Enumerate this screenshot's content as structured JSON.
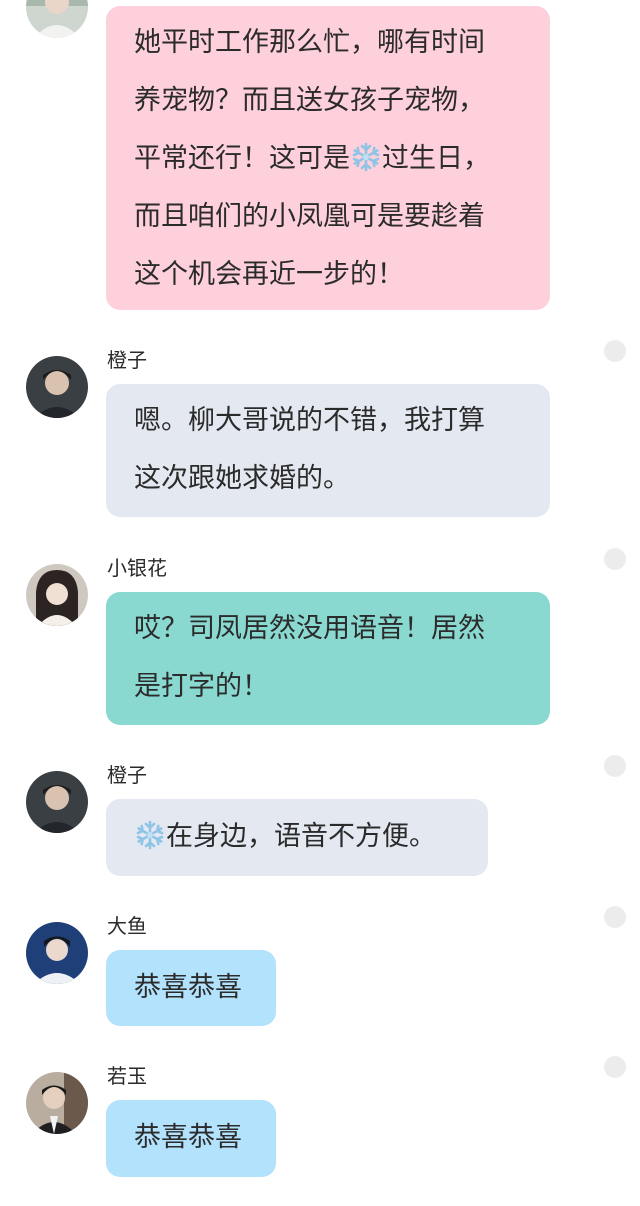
{
  "colors": {
    "pink_bubble": "#fdd0db",
    "gray_bubble": "#e3e8f1",
    "teal_bubble": "#8ad9d0",
    "blue_bubble": "#b3e2fd",
    "unread_dot": "#ececec",
    "snowflake": "#8fc4e6"
  },
  "messages": [
    {
      "sender": "",
      "avatar": "avatar-girl-light",
      "lines": [
        "她平时工作那么忙，哪有时间",
        "养宠物？而且送女孩子宠物，",
        "平常还行！这可是",
        "过生日，",
        "而且咱们的小凤凰可是要趁着",
        "这个机会再近一步的！"
      ],
      "snowflake_icon": "snowflake-icon"
    },
    {
      "sender": "橙子",
      "avatar": "avatar-boy-dark",
      "lines": [
        "嗯。柳大哥说的不错，我打算",
        "这次跟她求婚的。"
      ]
    },
    {
      "sender": "小银花",
      "avatar": "avatar-girl-dark-hair",
      "lines": [
        "哎？司凤居然没用语音！居然",
        "是打字的！"
      ]
    },
    {
      "sender": "橙子",
      "avatar": "avatar-boy-dark",
      "lines": [
        "在身边，语音不方便。"
      ],
      "snowflake_icon": "snowflake-icon"
    },
    {
      "sender": "大鱼",
      "avatar": "avatar-boy-blue",
      "lines": [
        "恭喜恭喜"
      ]
    },
    {
      "sender": "若玉",
      "avatar": "avatar-boy-suit",
      "lines": [
        "恭喜恭喜"
      ]
    }
  ]
}
